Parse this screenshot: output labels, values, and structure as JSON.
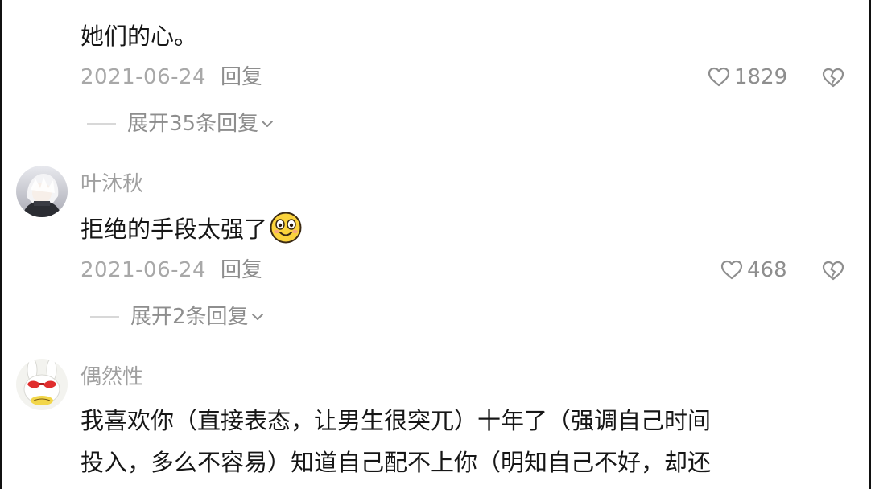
{
  "comments": [
    {
      "text_lines": [
        "她们的心。"
      ],
      "date": "2021-06-24",
      "reply_label": "回复",
      "likes": "1829",
      "expand_label": "展开35条回复"
    },
    {
      "username": "叶沐秋",
      "text": "拒绝的手段太强了",
      "emoji": "smile-emoji",
      "date": "2021-06-24",
      "reply_label": "回复",
      "likes": "468",
      "expand_label": "展开2条回复"
    },
    {
      "username": "偶然性",
      "text_lines": [
        "我喜欢你（直接表态，让男生很突兀）十年了（强调自己时间",
        "投入，多么不容易）知道自己配不上你（明知自己不好，却还"
      ]
    }
  ],
  "icons": {
    "like": "heart-outline-icon",
    "dislike": "broken-heart-icon",
    "expand": "chevron-down-icon"
  },
  "colors": {
    "text": "#161616",
    "meta": "#a8a8a8",
    "secondary": "#8e8e8e",
    "divider": "#d8d8d8"
  }
}
